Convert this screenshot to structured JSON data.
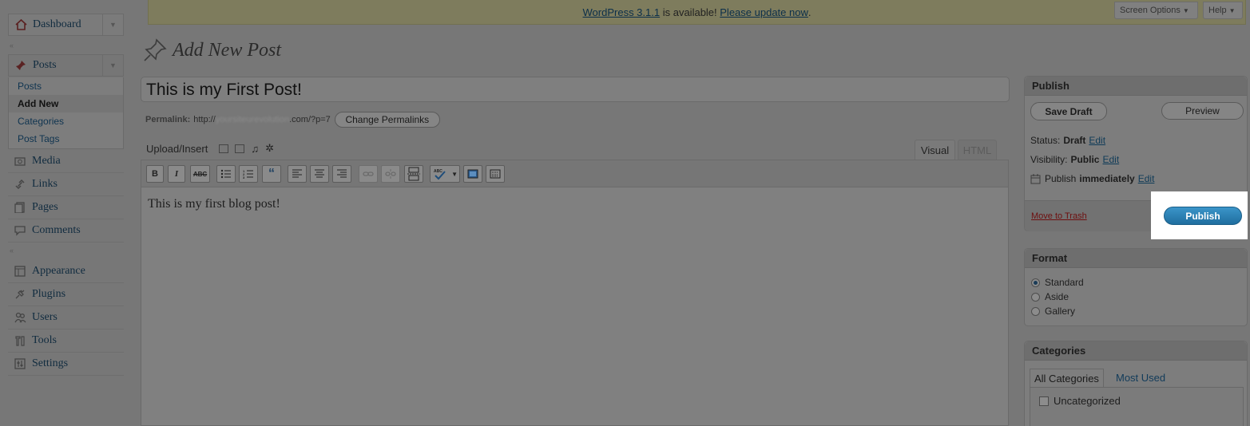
{
  "update_nag": {
    "version_link": "WordPress 3.1.1",
    "middle": " is available! ",
    "update_link": "Please update now",
    "end": "."
  },
  "top_buttons": {
    "screen_options": "Screen Options",
    "help": "Help"
  },
  "sidebar": {
    "dashboard": "Dashboard",
    "posts": "Posts",
    "posts_sub": [
      "Posts",
      "Add New",
      "Categories",
      "Post Tags"
    ],
    "media": "Media",
    "links": "Links",
    "pages": "Pages",
    "comments": "Comments",
    "appearance": "Appearance",
    "plugins": "Plugins",
    "users": "Users",
    "tools": "Tools",
    "settings": "Settings"
  },
  "page_title": "Add New Post",
  "post": {
    "title": "This is my First Post!",
    "permalink_label": "Permalink:",
    "permalink_prefix": "http://",
    "permalink_blurred": "yoursiteurevolution",
    "permalink_suffix": ".com/?p=7",
    "change_permalinks": "Change Permalinks",
    "content": "This is my first blog post!"
  },
  "editor": {
    "upload_label": "Upload/Insert",
    "tab_visual": "Visual",
    "tab_html": "HTML"
  },
  "toolbar": {
    "bold": "B",
    "italic": "I",
    "strike": "ABC"
  },
  "publish_box": {
    "title": "Publish",
    "save_draft": "Save Draft",
    "preview": "Preview",
    "status_label": "Status:",
    "status_value": "Draft",
    "visibility_label": "Visibility:",
    "visibility_value": "Public",
    "publish_label": "Publish",
    "publish_value": "immediately",
    "edit": "Edit",
    "move_to_trash": "Move to Trash",
    "publish_button": "Publish"
  },
  "format_box": {
    "title": "Format",
    "options": [
      "Standard",
      "Aside",
      "Gallery"
    ],
    "selected": "Standard"
  },
  "categories_box": {
    "title": "Categories",
    "tab_all": "All Categories",
    "tab_most_used": "Most Used",
    "items": [
      "Uncategorized"
    ]
  },
  "colors": {
    "overlay_bg": "#777777",
    "publish_blue": "#2a82b8",
    "highlight": "#ffffff"
  }
}
